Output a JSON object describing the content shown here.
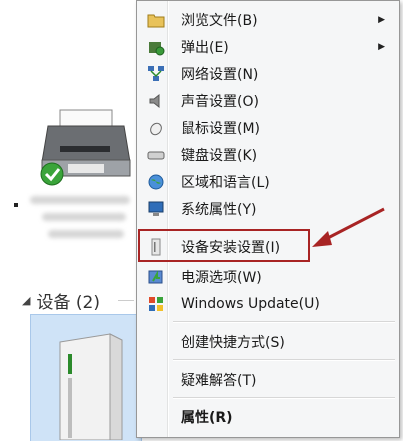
{
  "devices_header": {
    "label": "设备 (2)"
  },
  "context_menu": {
    "items": [
      {
        "label": "浏览文件(B)",
        "icon": "folder-icon",
        "submenu": true
      },
      {
        "label": "弹出(E)",
        "icon": "eject-icon",
        "submenu": true
      },
      {
        "label": "网络设置(N)",
        "icon": "network-icon"
      },
      {
        "label": "声音设置(O)",
        "icon": "speaker-icon"
      },
      {
        "label": "鼠标设置(M)",
        "icon": "mouse-icon"
      },
      {
        "label": "键盘设置(K)",
        "icon": "keyboard-icon"
      },
      {
        "label": "区域和语言(L)",
        "icon": "globe-icon"
      },
      {
        "label": "系统属性(Y)",
        "icon": "computer-icon"
      },
      {
        "label": "设备安装设置(I)",
        "icon": "device-install-icon",
        "highlighted": true
      },
      {
        "label": "电源选项(W)",
        "icon": "power-icon"
      },
      {
        "label": "Windows Update(U)",
        "icon": "windows-update-icon"
      },
      {
        "label": "创建快捷方式(S)"
      },
      {
        "label": "疑难解答(T)"
      },
      {
        "label": "属性(R)",
        "bold": true
      }
    ]
  },
  "colors": {
    "highlight": "#a82424",
    "tile": "#cfe3f7",
    "menu_bg": "#f5f6f7"
  }
}
